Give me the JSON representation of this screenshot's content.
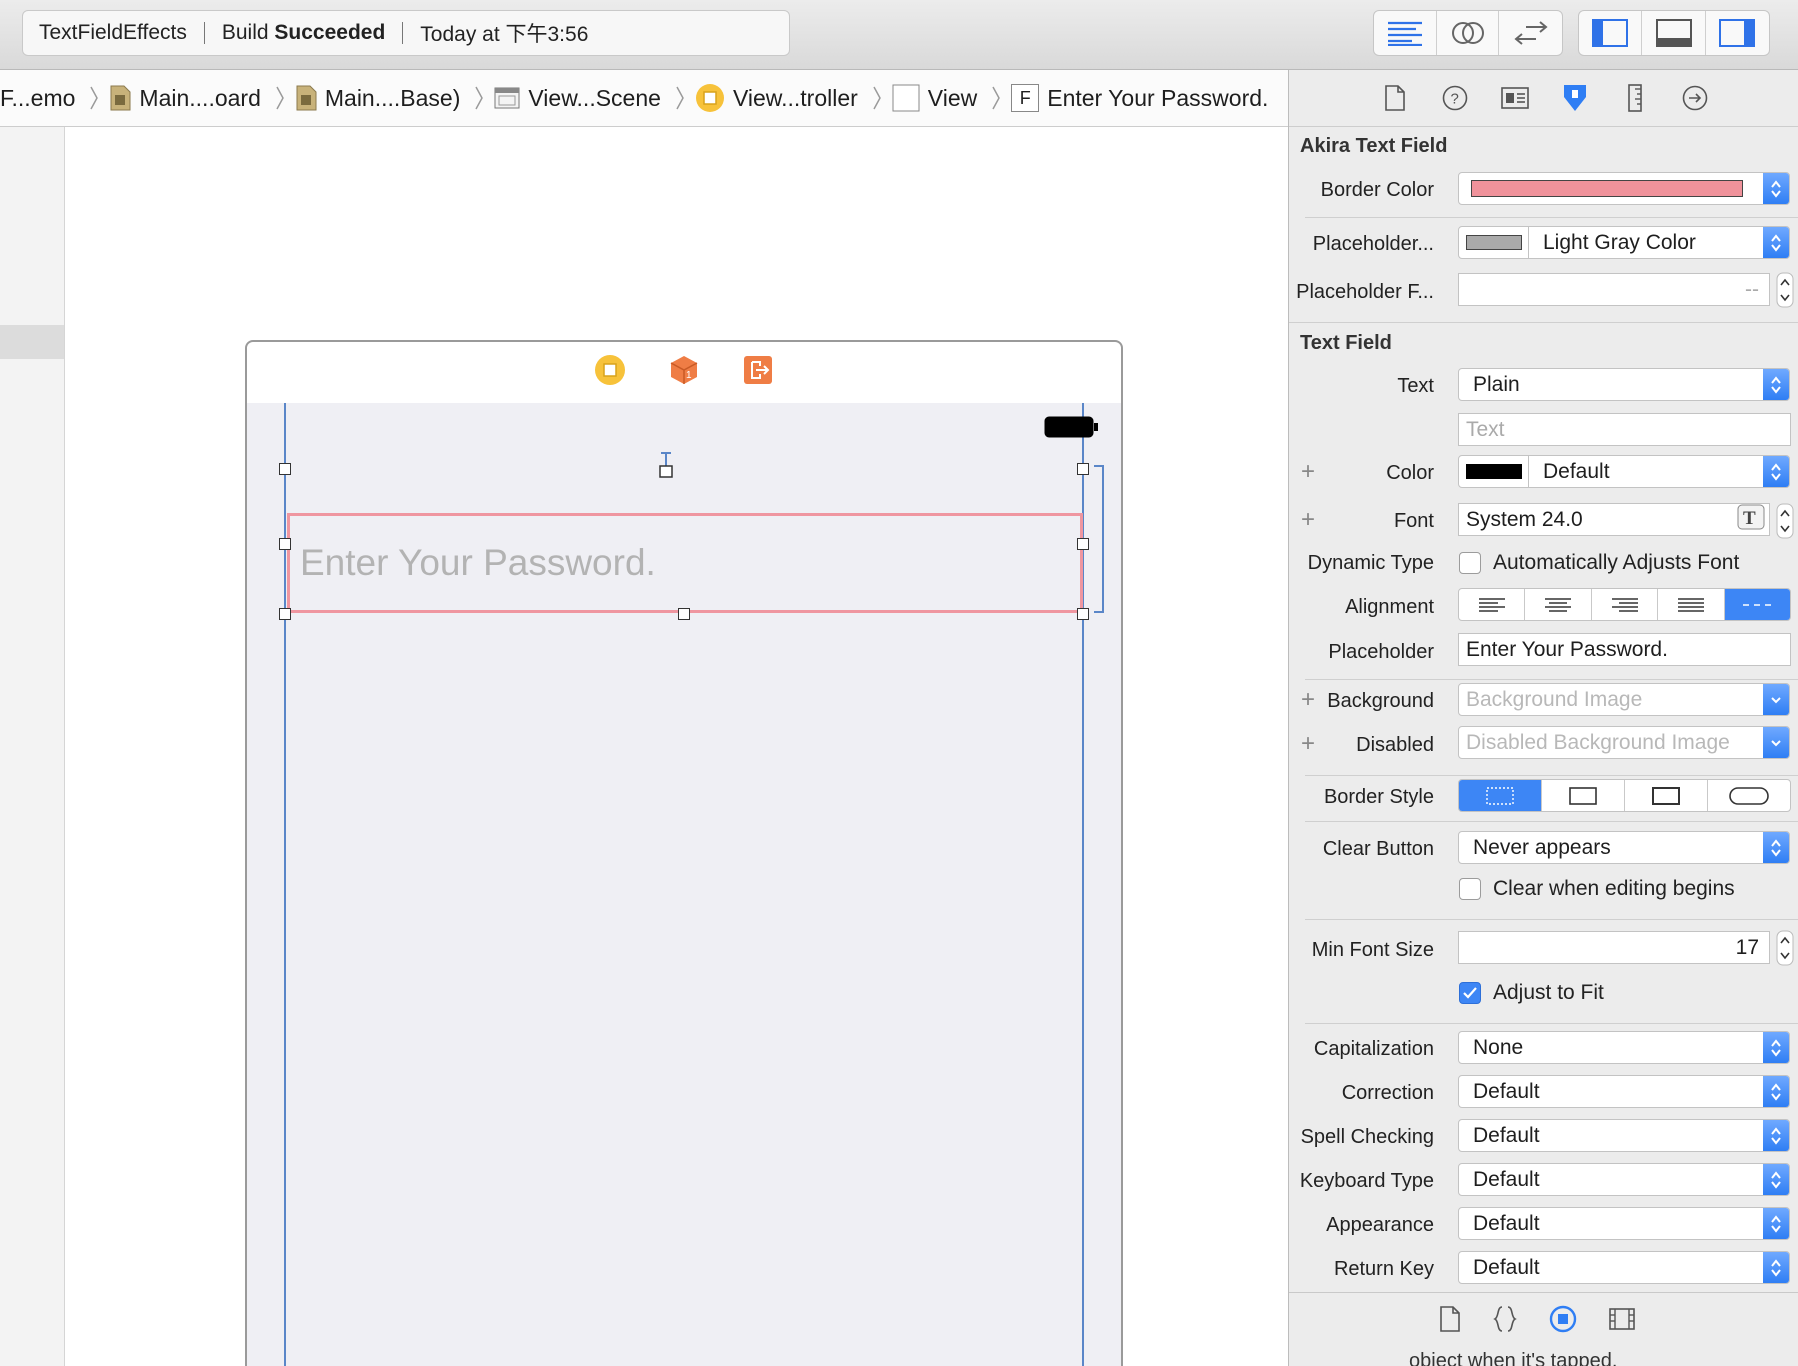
{
  "status": {
    "project": "TextFieldEffects",
    "build_prefix": "Build",
    "build_result": "Succeeded",
    "time": "Today at 下午3:56"
  },
  "toolbar": {
    "editor_buttons": [
      "standard-editor-icon",
      "assistant-editor-icon",
      "version-editor-icon"
    ],
    "panel_buttons": [
      "navigator-panel-icon",
      "debug-panel-icon",
      "utilities-panel-icon"
    ]
  },
  "breadcrumbs": [
    {
      "label": "F...emo",
      "icon": "project-icon"
    },
    {
      "label": "Main....oard",
      "icon": "storyboard-icon"
    },
    {
      "label": "Main....Base)",
      "icon": "storyboard-icon"
    },
    {
      "label": "View...Scene",
      "icon": "scene-icon"
    },
    {
      "label": "View...troller",
      "icon": "view-controller-icon"
    },
    {
      "label": "View",
      "icon": "view-icon"
    },
    {
      "label": "Enter Your Password.",
      "icon": "textfield-icon",
      "icon_letter": "F"
    }
  ],
  "canvas": {
    "dock_icons": [
      "view-controller-icon",
      "first-responder-icon",
      "exit-icon"
    ],
    "textfield_placeholder": "Enter Your Password.",
    "colors": {
      "border": "#ef96a0",
      "guide": "#5a86c8"
    }
  },
  "inspector": {
    "tabs": [
      "file-inspector-icon",
      "quick-help-icon",
      "identity-inspector-icon",
      "attributes-inspector-icon",
      "size-inspector-icon",
      "connections-inspector-icon"
    ],
    "akira": {
      "title": "Akira Text Field",
      "border_color_label": "Border Color",
      "border_color": "#f0929b",
      "placeholder_label": "Placeholder...",
      "placeholder_value": "Light Gray Color",
      "placeholder_swatch": "#aaaaaa",
      "placeholder_font_label": "Placeholder F...",
      "placeholder_font_value": "--"
    },
    "textfield": {
      "title": "Text Field",
      "text_label": "Text",
      "text_value": "Plain",
      "text_field_placeholder": "Text",
      "color_label": "Color",
      "color_value": "Default",
      "font_label": "Font",
      "font_value": "System 24.0",
      "dynamic_label": "Dynamic Type",
      "dynamic_check": "Automatically Adjusts Font",
      "alignment_label": "Alignment",
      "placeholder_label": "Placeholder",
      "placeholder_value": "Enter Your Password.",
      "background_label": "Background",
      "background_placeholder": "Background Image",
      "disabled_label": "Disabled",
      "disabled_placeholder": "Disabled Background Image",
      "border_style_label": "Border Style",
      "clear_button_label": "Clear Button",
      "clear_button_value": "Never appears",
      "clear_editing": "Clear when editing begins",
      "min_font_label": "Min Font Size",
      "min_font_value": "17",
      "adjust_label": "Adjust to Fit",
      "capitalization_label": "Capitalization",
      "capitalization_value": "None",
      "correction_label": "Correction",
      "correction_value": "Default",
      "spell_label": "Spell Checking",
      "spell_value": "Default",
      "keyboard_label": "Keyboard Type",
      "keyboard_value": "Default",
      "appearance_label": "Appearance",
      "appearance_value": "Default",
      "return_label": "Return Key",
      "return_value": "Default"
    },
    "library_tabs": [
      "file-template-icon",
      "code-snippet-icon",
      "object-library-icon",
      "media-library-icon"
    ],
    "library_text": "object when it's tapped."
  }
}
